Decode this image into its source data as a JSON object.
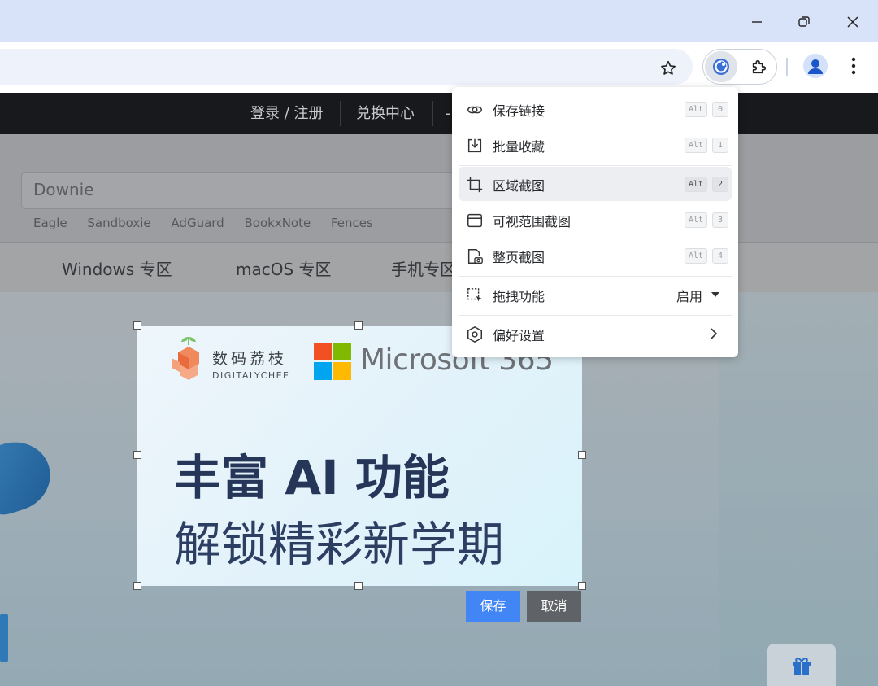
{
  "window": {
    "minimize_icon": "minimize-icon",
    "restore_icon": "restore-icon",
    "close_icon": "close-icon"
  },
  "toolbar": {
    "bookmark_icon": "star-icon",
    "extension_active_icon": "screenshot-extension-icon",
    "extensions_icon": "puzzle-icon",
    "profile_icon": "profile-icon",
    "menu_icon": "kebab-menu-icon"
  },
  "site": {
    "topbar": {
      "login": "登录 / 注册",
      "redeem": "兑换中心",
      "partial": "-"
    },
    "search": {
      "value": "Downie"
    },
    "tags": [
      "Eagle",
      "Sandboxie",
      "AdGuard",
      "BookxNote",
      "Fences"
    ],
    "nav": {
      "windows": "Windows 专区",
      "macos": "macOS 专区",
      "mobile": "手机专区"
    }
  },
  "banner": {
    "brand_cn": "数码荔枝",
    "brand_en": "DIGITALYCHEE",
    "partner": "Microsoft 365",
    "headline": "丰富 AI 功能",
    "subline": "解锁精彩新学期"
  },
  "selection": {
    "save": "保存",
    "cancel": "取消",
    "save_color": "#4285f4",
    "cancel_color": "#5f6266"
  },
  "menu": {
    "items": [
      {
        "label": "保存链接",
        "icon": "link-icon",
        "alt": "Alt",
        "key": "0"
      },
      {
        "label": "批量收藏",
        "icon": "download-box-icon",
        "alt": "Alt",
        "key": "1"
      },
      {
        "label": "区域截图",
        "icon": "crop-icon",
        "alt": "Alt",
        "key": "2"
      },
      {
        "label": "可视范围截图",
        "icon": "window-icon",
        "alt": "Alt",
        "key": "3"
      },
      {
        "label": "整页截图",
        "icon": "fullpage-camera-icon",
        "alt": "Alt",
        "key": "4"
      },
      {
        "label": "拖拽功能",
        "icon": "drag-select-icon",
        "value": "启用"
      },
      {
        "label": "偏好设置",
        "icon": "settings-hexagon-icon"
      }
    ]
  }
}
